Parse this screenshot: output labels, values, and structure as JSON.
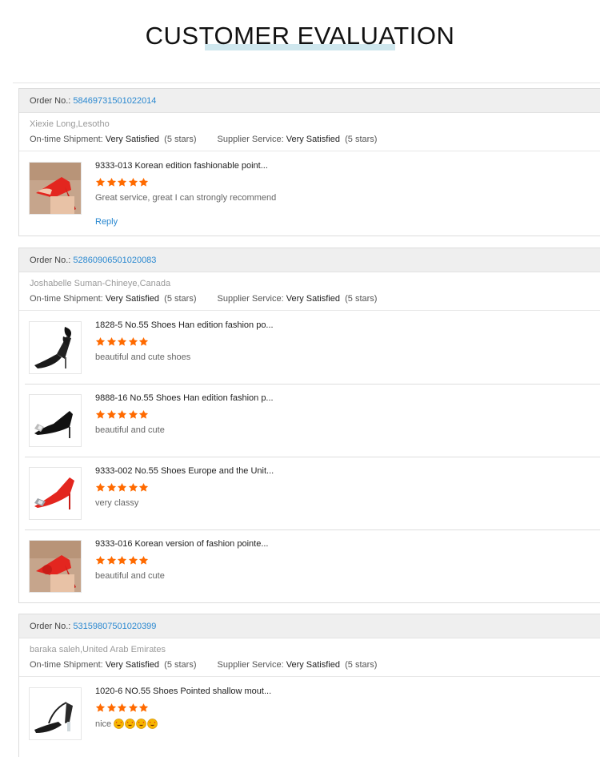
{
  "page": {
    "title": "CUSTOMER EVALUATION"
  },
  "labels": {
    "order_no": "Order No.:",
    "ontime": "On-time Shipment:",
    "supplier": "Supplier Service:",
    "reply": "Reply"
  },
  "colors": {
    "accent_link": "#2a88d0",
    "star": "#ff6a00",
    "header_bg": "#efefef",
    "title_underline": "#cfe7ee"
  },
  "orders": [
    {
      "number": "58469731501022014",
      "buyer": "Xiexie Long,Lesotho",
      "ontime_value": "Very Satisfied",
      "ontime_stars": "(5 stars)",
      "supplier_value": "Very Satisfied",
      "supplier_stars": "(5 stars)",
      "items": [
        {
          "title": "9333-013 Korean edition fashionable point...",
          "rating": 5,
          "review": "Great service, great I can strongly recommend",
          "thumb": "red-heel-photo"
        }
      ]
    },
    {
      "number": "52860906501020083",
      "buyer": "Joshabelle Suman-Chineye,Canada",
      "ontime_value": "Very Satisfied",
      "ontime_stars": "(5 stars)",
      "supplier_value": "Very Satisfied",
      "supplier_stars": "(5 stars)",
      "items": [
        {
          "title": "1828-5 No.55 Shoes Han edition fashion po...",
          "rating": 5,
          "review": "beautiful and cute shoes",
          "thumb": "black-bow-heel"
        },
        {
          "title": "9888-16 No.55 Shoes Han edition fashion p...",
          "rating": 5,
          "review": "beautiful and cute",
          "thumb": "black-patent-heel"
        },
        {
          "title": "9333-002 No.55 Shoes Europe and the Unit...",
          "rating": 5,
          "review": "very classy",
          "thumb": "red-crystal-heel"
        },
        {
          "title": "9333-016 Korean version of fashion pointe...",
          "rating": 5,
          "review": "beautiful and cute",
          "thumb": "red-heel-photo"
        }
      ]
    },
    {
      "number": "53159807501020399",
      "buyer": "baraka saleh,United Arab Emirates",
      "ontime_value": "Very Satisfied",
      "ontime_stars": "(5 stars)",
      "supplier_value": "Very Satisfied",
      "supplier_stars": "(5 stars)",
      "items": [
        {
          "title": "1020-6 NO.55 Shoes Pointed shallow mout...",
          "rating": 5,
          "review": "nice",
          "emoji": [
            "heart-eyes-emoji",
            "heart-eyes-emoji",
            "heart-eyes-emoji",
            "heart-eyes-emoji"
          ],
          "thumb": "black-mesh-heel"
        }
      ]
    }
  ]
}
